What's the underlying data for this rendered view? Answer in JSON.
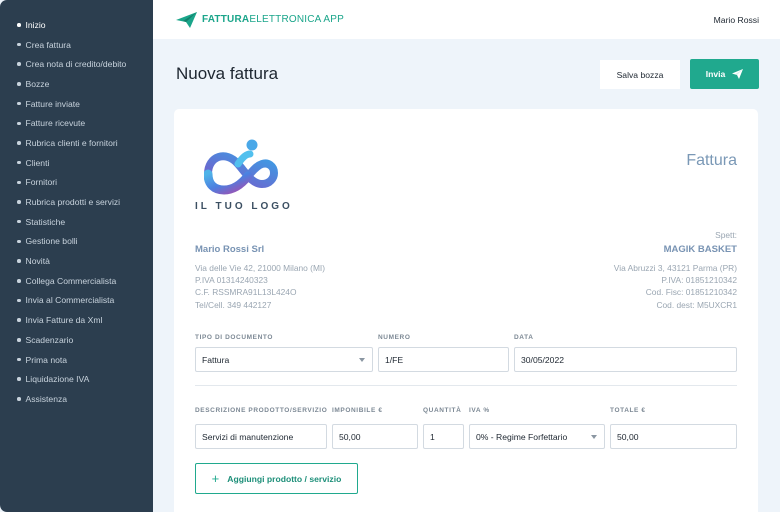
{
  "sidebar": {
    "items": [
      {
        "label": "Inizio"
      },
      {
        "label": "Crea fattura"
      },
      {
        "label": "Crea nota di credito/debito"
      },
      {
        "label": "Bozze"
      },
      {
        "label": "Fatture inviate"
      },
      {
        "label": "Fatture ricevute"
      },
      {
        "label": "Rubrica clienti e fornitori"
      },
      {
        "label": "Clienti"
      },
      {
        "label": "Fornitori"
      },
      {
        "label": "Rubrica prodotti e servizi"
      },
      {
        "label": "Statistiche"
      },
      {
        "label": "Gestione bolli"
      },
      {
        "label": "Novità"
      },
      {
        "label": "Collega Commercialista"
      },
      {
        "label": "Invia al Commercialista"
      },
      {
        "label": "Invia Fatture da Xml"
      },
      {
        "label": "Scadenzario"
      },
      {
        "label": "Prima nota"
      },
      {
        "label": "Liquidazione IVA"
      },
      {
        "label": "Assistenza"
      }
    ]
  },
  "header": {
    "brand_bold": "FATTURA",
    "brand_light": "ELETTRONICA APP",
    "user": "Mario Rossi"
  },
  "page": {
    "title": "Nuova fattura",
    "draft_label": "Salva bozza",
    "send_label": "Invia"
  },
  "invoice": {
    "logo_text": "IL TUO LOGO",
    "heading": "Fattura",
    "seller": {
      "name": "Mario Rossi Srl",
      "address": "Via delle Vie 42, 21000 Milano (MI)",
      "piva": "P.IVA 01314240323",
      "cf": "C.F. RSSMRA91L13L424O",
      "tel": "Tel/Cell. 349 442127"
    },
    "buyer": {
      "prefix": "Spett:",
      "name": "MAGIK BASKET",
      "address": "Via Abruzzi 3, 43121 Parma (PR)",
      "piva": "P.IVA: 01851210342",
      "cf": "Cod. Fisc: 01851210342",
      "dest": "Cod. dest: M5UXCR1"
    },
    "doc_fields": {
      "type_label": "TIPO DI DOCUMENTO",
      "type_value": "Fattura",
      "number_label": "NUMERO",
      "number_value": "1/FE",
      "date_label": "DATA",
      "date_value": "30/05/2022"
    },
    "line_item": {
      "desc_label": "DESCRIZIONE PRODOTTO/SERVIZIO",
      "desc_value": "Servizi di manutenzione",
      "taxable_label": "IMPONIBILE €",
      "taxable_value": "50,00",
      "qty_label": "QUANTITÀ",
      "qty_value": "1",
      "vat_label": "IVA %",
      "vat_value": "0% - Regime Forfettario",
      "total_label": "TOTALE €",
      "total_value": "50,00"
    },
    "add_label": "Aggiungi prodotto / servizio"
  },
  "colors": {
    "accent": "#20a98e",
    "sidebar_bg": "#2c3e4f",
    "page_bg": "#eef4fa"
  }
}
